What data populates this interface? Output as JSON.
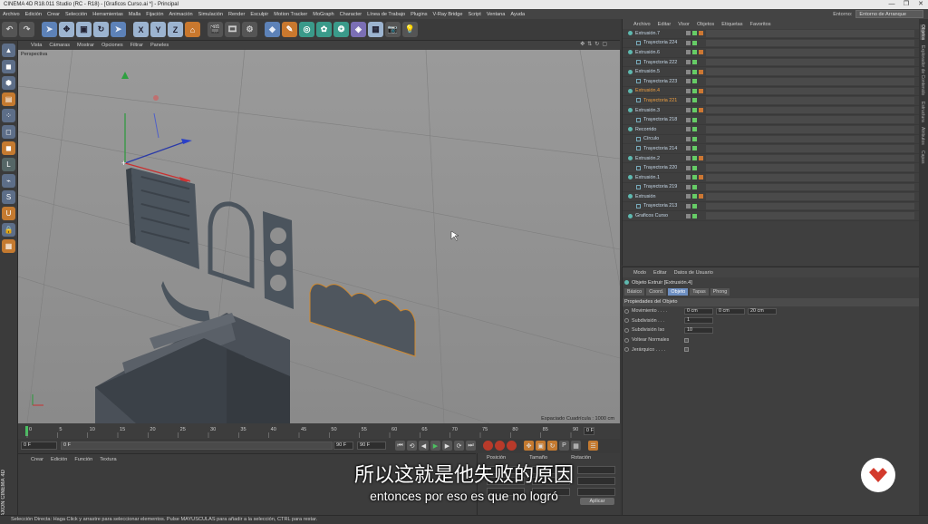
{
  "window": {
    "title": "CINEMA 4D R18.011 Studio (RC - R18) - [Graficos Curso.ai *] - Principal",
    "controls": [
      "—",
      "❐",
      "✕"
    ]
  },
  "menubar": {
    "items": [
      "Archivo",
      "Edición",
      "Crear",
      "Selección",
      "Herramientas",
      "Malla",
      "Fijación",
      "Animación",
      "Simulación",
      "Render",
      "Esculpir",
      "Motion Tracker",
      "MoGraph",
      "Character",
      "Línea de Trabajo",
      "Plugins",
      "V-Ray Bridge",
      "Script",
      "Ventana",
      "Ayuda"
    ],
    "entorno_label": "Entorno:",
    "entorno_value": "Entorno de Arranque"
  },
  "viewport": {
    "menu": [
      "Vista",
      "Cámaras",
      "Mostrar",
      "Opciones",
      "Filtrar",
      "Paneles"
    ],
    "view_name": "Perspectiva",
    "grid_spacing": "Espaciado Cuadrícula : 1000 cm",
    "bg": "#8d8d8d"
  },
  "timeline": {
    "ticks": [
      "0",
      "5",
      "10",
      "15",
      "20",
      "25",
      "30",
      "35",
      "40",
      "45",
      "50",
      "55",
      "60",
      "65",
      "70",
      "75",
      "80",
      "85",
      "90"
    ],
    "end_frame": "0 F"
  },
  "transport": {
    "start": "0 F",
    "start2": "0 F",
    "end": "90 F",
    "end2": "90 F"
  },
  "material_manager": {
    "menu": [
      "Crear",
      "Edición",
      "Función",
      "Textura"
    ]
  },
  "coordinates": {
    "headers": [
      "Posición",
      "Tamaño",
      "Rotación"
    ],
    "apply": "Aplicar"
  },
  "object_manager": {
    "menu": [
      "Archivo",
      "Editar",
      "Visor",
      "Objetos",
      "Etiquetas",
      "Favoritos"
    ],
    "rows": [
      {
        "name": "Extrusión.7",
        "indent": 0,
        "type": "ext"
      },
      {
        "name": "Trayectoria 224",
        "indent": 1,
        "type": "spline"
      },
      {
        "name": "Extrusión.6",
        "indent": 0,
        "type": "ext"
      },
      {
        "name": "Trayectoria 222",
        "indent": 1,
        "type": "spline"
      },
      {
        "name": "Extrusión.5",
        "indent": 0,
        "type": "ext"
      },
      {
        "name": "Trayectoria 223",
        "indent": 1,
        "type": "spline"
      },
      {
        "name": "Extrusión.4",
        "indent": 0,
        "type": "ext",
        "selected": true
      },
      {
        "name": "Trayectoria 221",
        "indent": 1,
        "type": "spline",
        "selected": true
      },
      {
        "name": "Extrusión.3",
        "indent": 0,
        "type": "ext"
      },
      {
        "name": "Trayectoria 218",
        "indent": 1,
        "type": "spline"
      },
      {
        "name": "Recorrido",
        "indent": 0,
        "type": "sweep"
      },
      {
        "name": "Círculo",
        "indent": 1,
        "type": "spline"
      },
      {
        "name": "Trayectoria 214",
        "indent": 1,
        "type": "spline"
      },
      {
        "name": "Extrusión.2",
        "indent": 0,
        "type": "ext"
      },
      {
        "name": "Trayectoria 220",
        "indent": 1,
        "type": "spline"
      },
      {
        "name": "Extrusión.1",
        "indent": 0,
        "type": "ext"
      },
      {
        "name": "Trayectoria 219",
        "indent": 1,
        "type": "spline"
      },
      {
        "name": "Extrusión",
        "indent": 0,
        "type": "ext"
      },
      {
        "name": "Trayectoria 213",
        "indent": 1,
        "type": "spline"
      },
      {
        "name": "Graficos Curso",
        "indent": 0,
        "type": "null"
      }
    ]
  },
  "attributes": {
    "menu": [
      "Modo",
      "Editar",
      "Datos de Usuario"
    ],
    "title": "Objeto Extruir [Extrusión.4]",
    "tabs": [
      "Básico",
      "Coord.",
      "Objeto",
      "Tapas",
      "Phong"
    ],
    "active_tab": "Objeto",
    "section": "Propiedades del Objeto",
    "props": [
      {
        "label": "Movimiento . . . .",
        "values": [
          "0 cm",
          "0 cm",
          "20 cm"
        ]
      },
      {
        "label": "Subdivisión . . .",
        "values": [
          "1"
        ]
      },
      {
        "label": "Subdivisión Iso",
        "values": [
          "10"
        ]
      },
      {
        "label": "Voltear Normales",
        "checkbox": true
      },
      {
        "label": "Jerárquico . . . .",
        "checkbox": true
      }
    ]
  },
  "rightstrip": [
    "Objetos",
    "Explorador de Contenido",
    "Estructura",
    "Atributos",
    "Capas"
  ],
  "statusbar": "Selección Directa: Haga Click y arrastre para seleccionar elementos. Pulse MAYUSCULAS para añadir a la selección, CTRL para restar.",
  "subtitles": {
    "chinese": "所以这就是他失败的原因",
    "spanish": "entonces por eso es que no logró"
  },
  "branding": {
    "side_logo": "MAXON CINEMA 4D"
  }
}
